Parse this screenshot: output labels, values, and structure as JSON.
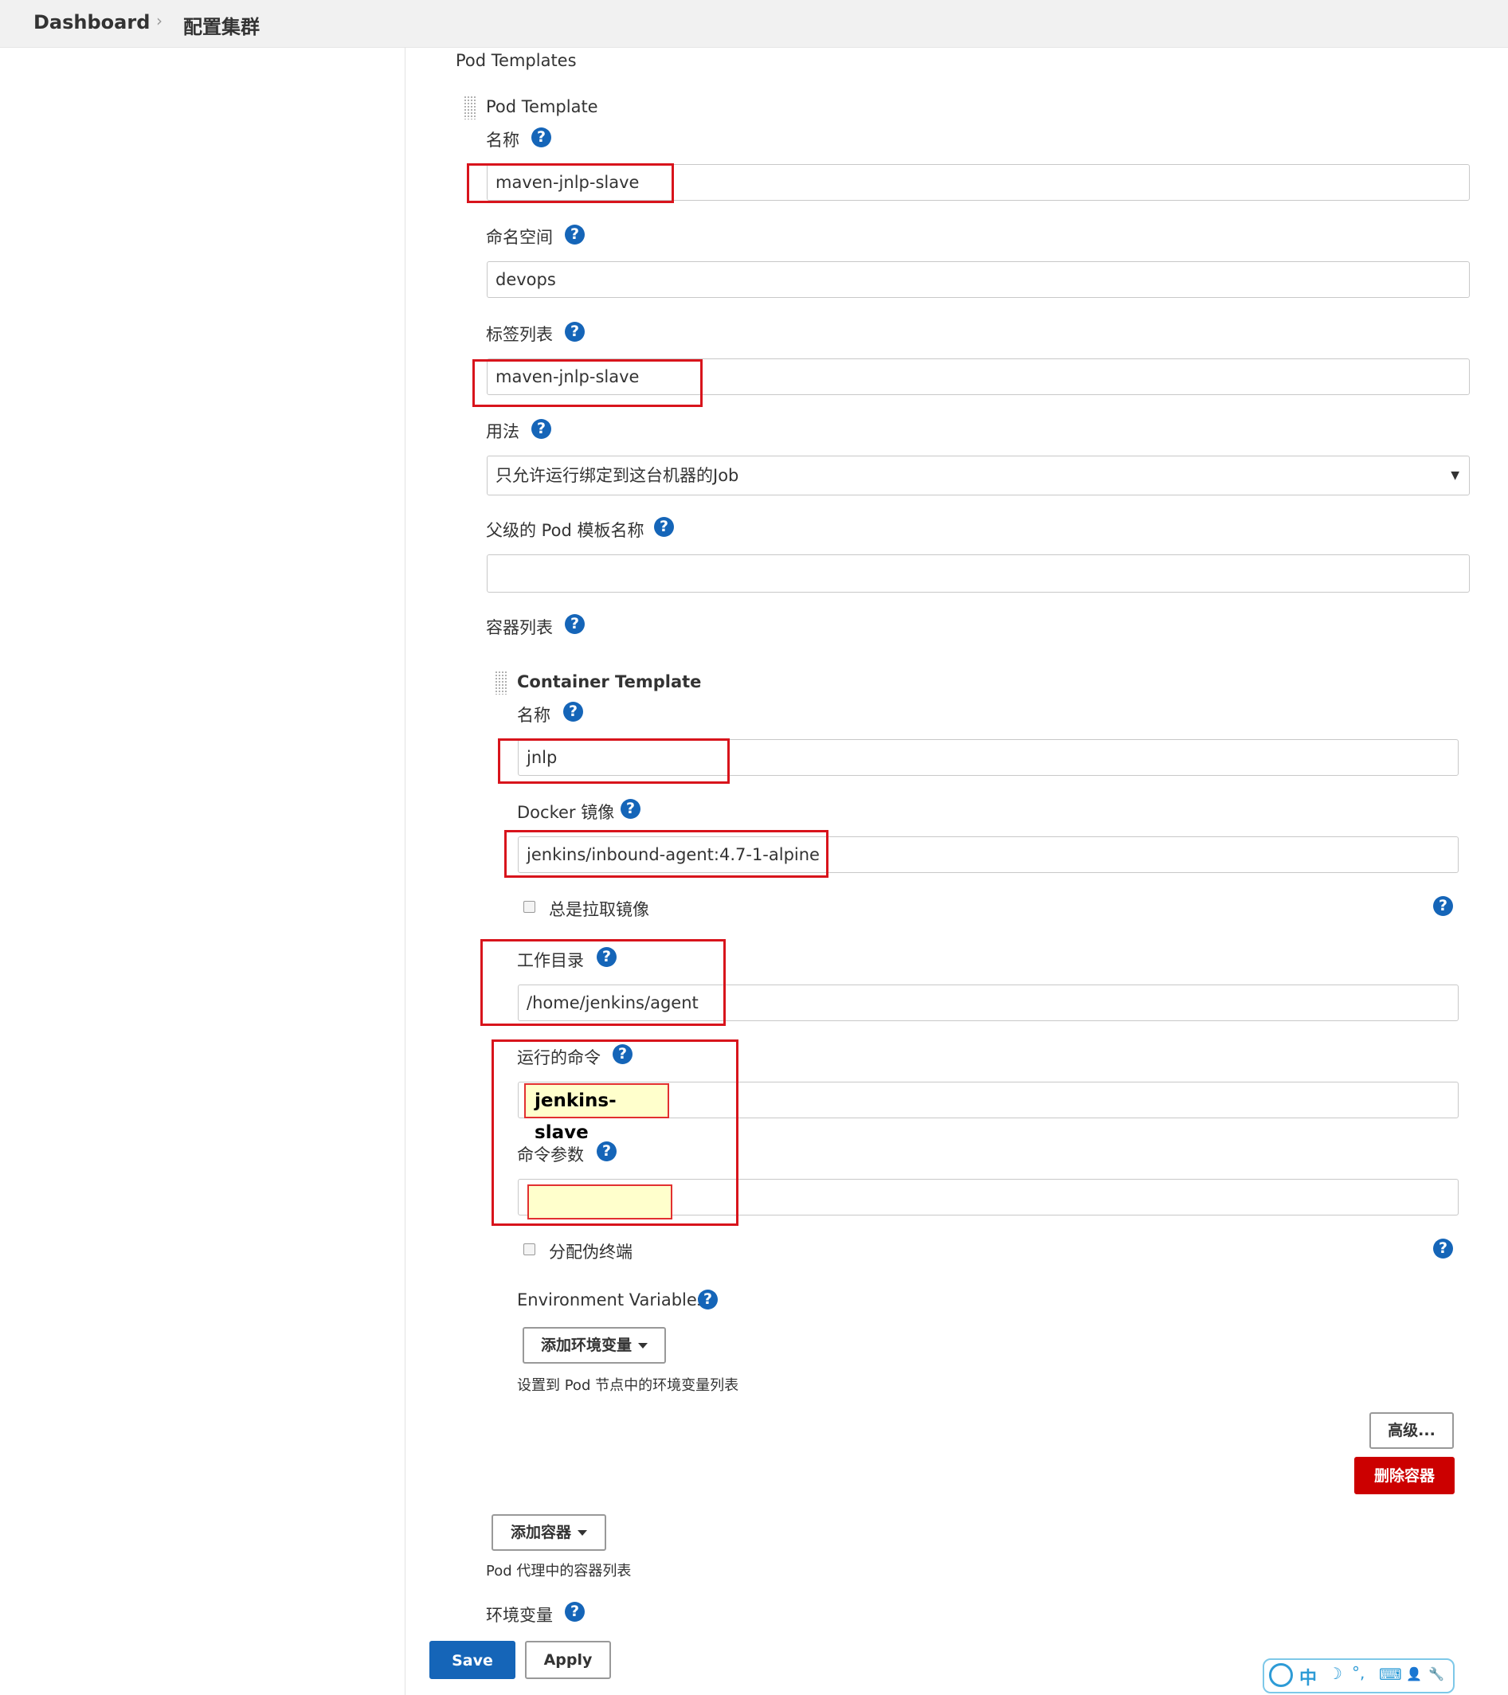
{
  "breadcrumb": {
    "home": "Dashboard",
    "separator": "›",
    "current": "配置集群"
  },
  "pod_templates": {
    "section_title": "Pod Templates",
    "template_title": "Pod Template",
    "name_label": "名称",
    "name_value": "maven-jnlp-slave",
    "namespace_label": "命名空间",
    "namespace_value": "devops",
    "labels_label": "标签列表",
    "labels_value": "maven-jnlp-slave",
    "usage_label": "用法",
    "usage_value": "只允许运行绑定到这台机器的Job",
    "parent_label": "父级的 Pod 模板名称",
    "parent_value": "",
    "containers_label": "容器列表"
  },
  "container": {
    "title": "Container Template",
    "name_label": "名称",
    "name_value": "jnlp",
    "image_label": "Docker 镜像",
    "image_value": "jenkins/inbound-agent:4.7-1-alpine",
    "always_pull_label": "总是拉取镜像",
    "workdir_label": "工作目录",
    "workdir_value": "/home/jenkins/agent",
    "command_label": "运行的命令",
    "command_value": "jenkins-slave",
    "args_label": "命令参数",
    "args_value": "",
    "tty_label": "分配伪终端",
    "env_label": "Environment Variables",
    "add_env_button": "添加环境变量",
    "env_note": "设置到 Pod 节点中的环境变量列表",
    "advanced_button": "高级...",
    "delete_button": "删除容器"
  },
  "add_container_button": "添加容器",
  "add_container_note": "Pod 代理中的容器列表",
  "pod_env_label": "环境变量",
  "save_button": "Save",
  "apply_button": "Apply",
  "help_glyph": "?",
  "colors": {
    "primary": "#1565b8",
    "danger": "#cc0000",
    "annotation": "#d8141c",
    "highlight": "#ffffcc"
  },
  "ime_toolbar": {
    "items": [
      "中",
      "☽",
      "°,",
      "⌨",
      "👤",
      "🔧"
    ]
  }
}
